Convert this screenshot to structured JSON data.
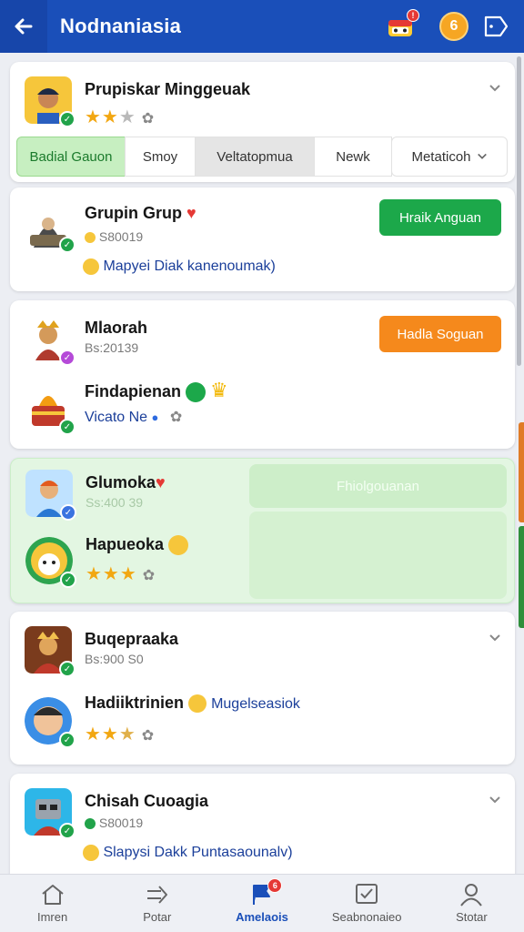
{
  "app": {
    "title": "Nodnaniasia",
    "notif_badge": "!",
    "coin_label": "6"
  },
  "cards": [
    {
      "name": "Prupiskar Minggeuak",
      "rating": 2.5,
      "tabs": [
        "Badial Gauon",
        "Smoy",
        "Veltatopmua",
        "Newk",
        "Metaticoh"
      ]
    },
    {
      "name": "Grupin Grup",
      "sub": "S80019",
      "link": "Mapyei Diak kanenoumak)",
      "button": "Hraik Anguan"
    },
    {
      "name": "Mlaorah",
      "sub": "Bs:20139",
      "name2": "Findapienan",
      "link": "Vicato Ne",
      "button": "Hadla Soguan"
    },
    {
      "name": "Glumoka",
      "sub": "Ss:400 39",
      "name2": "Hapueoka",
      "rating2": 3,
      "button": "Fhiolgouanan"
    },
    {
      "name": "Buqepraaka",
      "sub": "Bs:900 S0",
      "name2": "Hadiiktrinien",
      "link": "Mugelseasiok",
      "rating2": 2.5
    },
    {
      "name": "Chisah Cuoagia",
      "sub": "S80019",
      "link": "Slapysi Dakk Puntasaounalv)"
    }
  ],
  "tabbar": [
    {
      "label": "Imren",
      "icon": "home-icon"
    },
    {
      "label": "Potar",
      "icon": "forward-arrow-icon"
    },
    {
      "label": "Amelaois",
      "icon": "flag-icon",
      "badge": "6",
      "active": true
    },
    {
      "label": "Seabnonaieo",
      "icon": "checkbox-icon"
    },
    {
      "label": "Stotar",
      "icon": "user-icon"
    }
  ],
  "colors": {
    "brand": "#1a4fb9",
    "green": "#1ca84a",
    "orange": "#f5891c",
    "star": "#f2a712"
  }
}
